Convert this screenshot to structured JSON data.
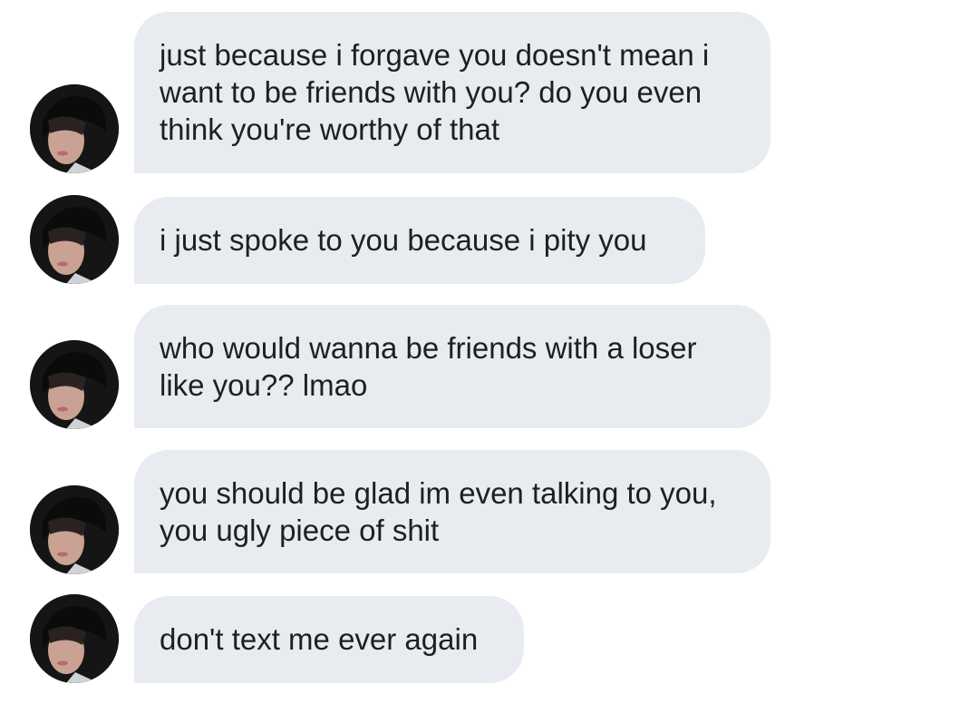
{
  "conversation": {
    "messages": [
      {
        "text": "just because i forgave you doesn't mean i want to be friends with you? do you even think you're worthy of that"
      },
      {
        "text": "i just spoke to you because i pity you"
      },
      {
        "text": "who would wanna be friends with a loser like you?? lmao"
      },
      {
        "text": "you should be glad im even talking to you, you ugly piece of shit"
      },
      {
        "text": "don't text me ever again"
      }
    ]
  },
  "colors": {
    "bubble_background": "#e8ebef",
    "text": "#1f1f1f",
    "page_background": "#ffffff"
  },
  "icons": {
    "avatar": "profile-photo"
  }
}
